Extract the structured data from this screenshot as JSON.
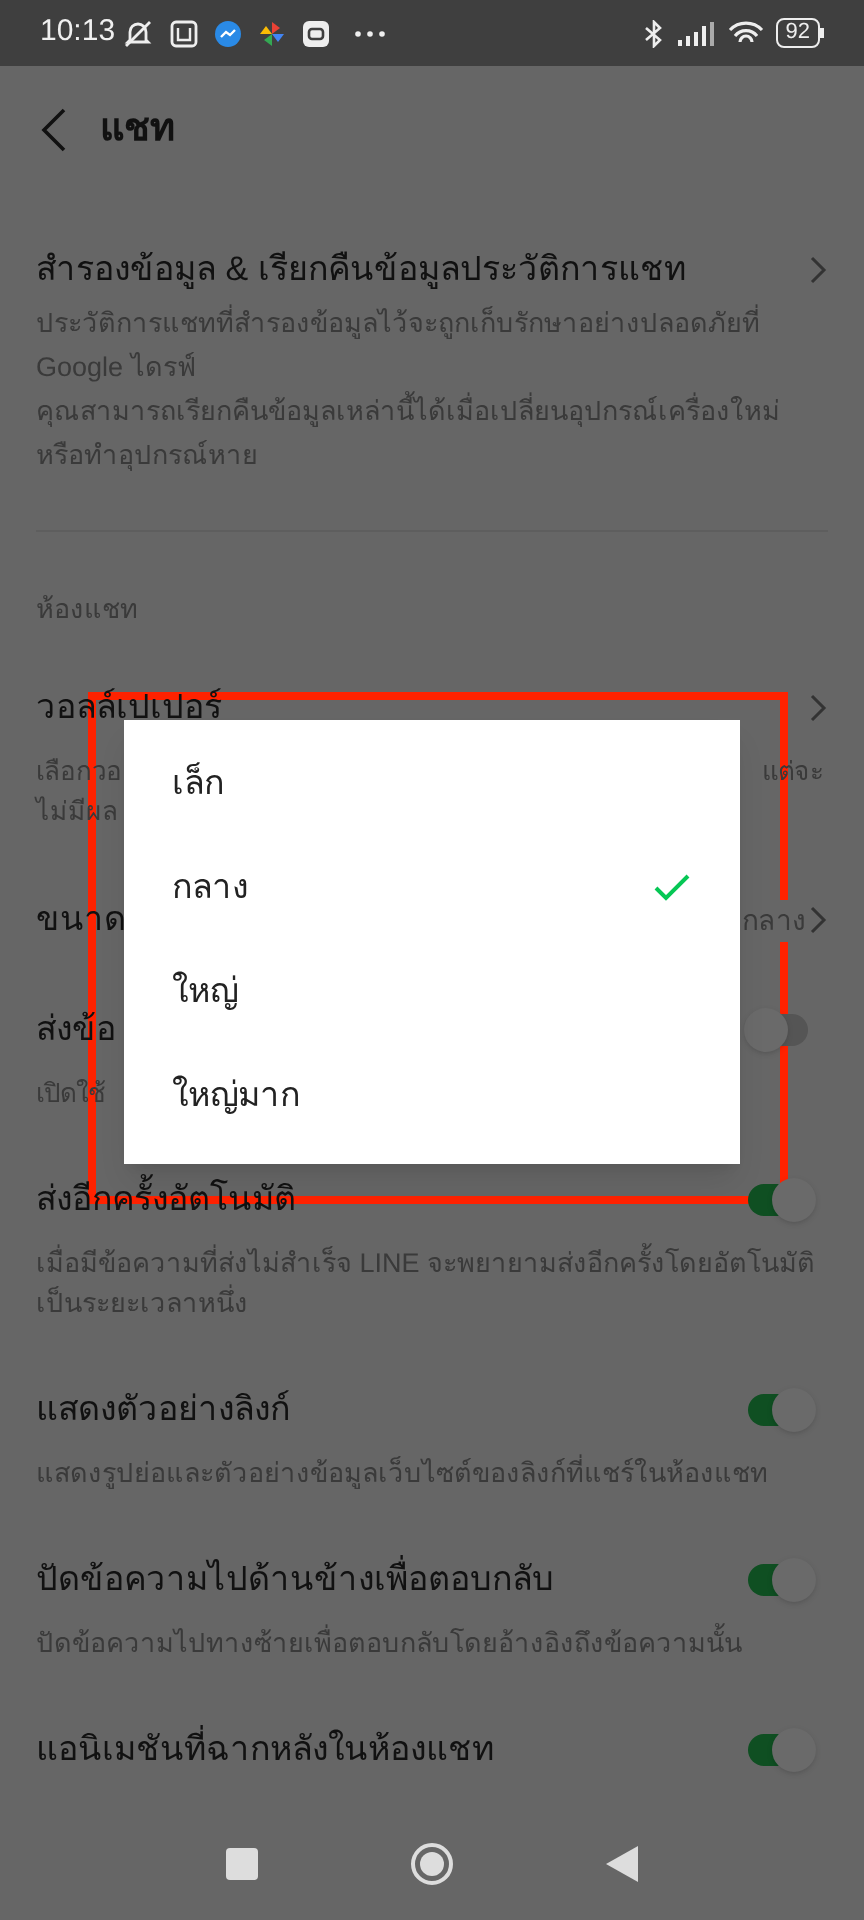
{
  "status_bar": {
    "time": "10:13",
    "battery": "92"
  },
  "header": {
    "title": "แชท"
  },
  "backup": {
    "title": "สำรองข้อมูล & เรียกคืนข้อมูลประวัติการแชท",
    "description": "ประวัติการแชทที่สำรองข้อมูลไว้จะถูกเก็บรักษาอย่างปลอดภัยที่ Google ไดรฟ์\nคุณสามารถเรียกคืนข้อมูลเหล่านี้ได้เมื่อเปลี่ยนอุปกรณ์เครื่องใหม่หรือทำอุปกรณ์หาย"
  },
  "section": "ห้องแชท",
  "covered_rows": [
    {
      "kind": "link",
      "title": "วอลล์เปเปอร์",
      "description_left": [
        "เลือกวอ",
        "ไม่มีผล"
      ],
      "description_right": "แต่จะ"
    },
    {
      "kind": "value",
      "title": "ขนาด",
      "value": "กลาง"
    },
    {
      "kind": "toggle",
      "title": "ส่งข้อ",
      "on": false,
      "description_left": [
        "เปิดใช้"
      ]
    }
  ],
  "toggles": [
    {
      "title": "ส่งอีกครั้งอัตโนมัติ",
      "description": "เมื่อมีข้อความที่ส่งไม่สำเร็จ LINE จะพยายามส่งอีกครั้งโดยอัตโนมัติเป็นระยะเวลาหนึ่ง",
      "on": true
    },
    {
      "title": "แสดงตัวอย่างลิงก์",
      "description": "แสดงรูปย่อและตัวอย่างข้อมูลเว็บไซต์ของลิงก์ที่แชร์ในห้องแชท",
      "on": true
    },
    {
      "title": "ปัดข้อความไปด้านข้างเพื่อตอบกลับ",
      "description": "ปัดข้อความไปทางซ้ายเพื่อตอบกลับโดยอ้างอิงถึงข้อความนั้น",
      "on": true
    },
    {
      "title": "แอนิเมชันที่ฉากหลังในห้องแชท",
      "on": true
    }
  ],
  "dialog": {
    "options": [
      {
        "label": "เล็ก",
        "selected": false
      },
      {
        "label": "กลาง",
        "selected": true
      },
      {
        "label": "ใหญ่",
        "selected": false
      },
      {
        "label": "ใหญ่มาก",
        "selected": false
      }
    ]
  }
}
